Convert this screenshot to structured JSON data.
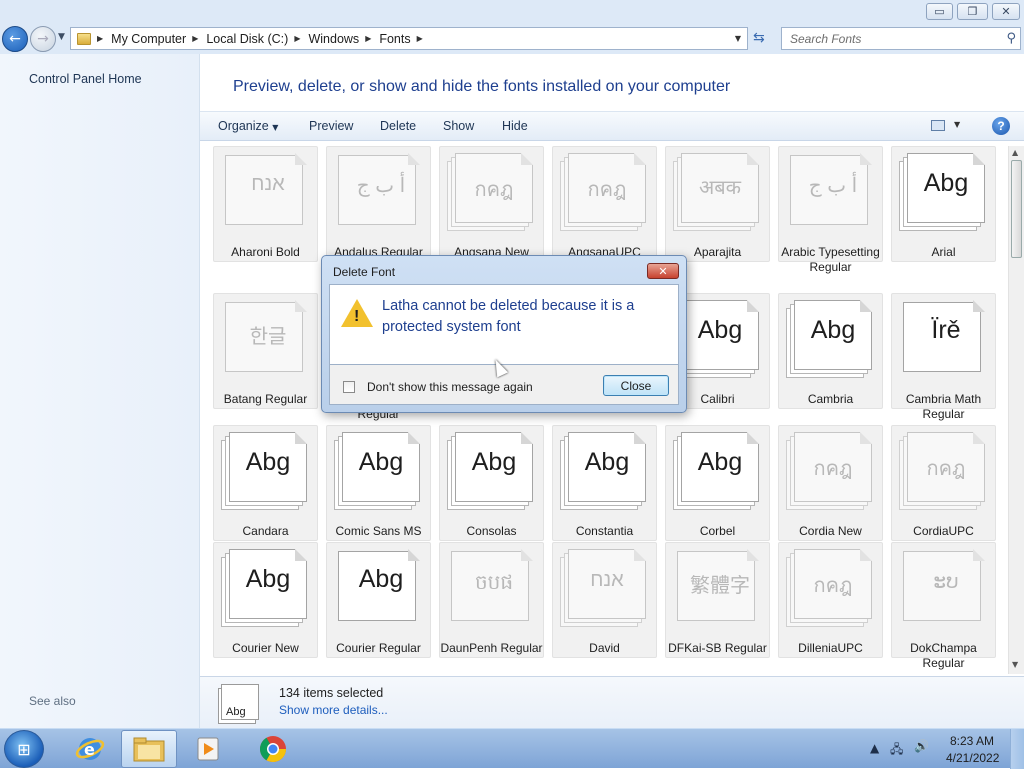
{
  "window": {
    "minimize_glyph": "▭",
    "restore_glyph": "❐",
    "close_glyph": "✕"
  },
  "nav": {
    "back_glyph": "←",
    "forward_glyph": "→"
  },
  "address": {
    "crumbs": [
      "My Computer",
      "Local Disk (C:)",
      "Windows",
      "Fonts"
    ]
  },
  "search": {
    "placeholder": "Search Fonts"
  },
  "sidebar": {
    "home_label": "Control Panel Home",
    "see_also_label": "See also"
  },
  "main": {
    "heading": "Preview, delete, or show and hide the fonts installed on your computer"
  },
  "toolbar": {
    "organize_label": "Organize",
    "preview_label": "Preview",
    "delete_label": "Delete",
    "show_label": "Show",
    "hide_label": "Hide",
    "help_label": "?"
  },
  "fonts": [
    {
      "name": "Aharoni Bold",
      "sample": "אנח",
      "disabled": true,
      "stack": false
    },
    {
      "name": "Andalus Regular",
      "sample": "أ ب ج",
      "disabled": true,
      "stack": false
    },
    {
      "name": "Angsana New",
      "sample": "กคฎ",
      "disabled": true,
      "stack": true
    },
    {
      "name": "AngsanaUPC",
      "sample": "กคฎ",
      "disabled": true,
      "stack": true
    },
    {
      "name": "Aparajita",
      "sample": "अबक",
      "disabled": true,
      "stack": true
    },
    {
      "name": "Arabic Typesetting Regular",
      "sample": "أ ب ج",
      "disabled": true,
      "stack": false
    },
    {
      "name": "Arial",
      "sample": "Abg",
      "disabled": false,
      "stack": true
    },
    {
      "name": "Batang Regular",
      "sample": "한글",
      "disabled": true,
      "stack": false
    },
    {
      "name": "Browallia New Regular",
      "sample": "",
      "disabled": true,
      "stack": true
    },
    {
      "name": "",
      "sample": "",
      "disabled": true,
      "stack": false
    },
    {
      "name": "",
      "sample": "",
      "disabled": true,
      "stack": false
    },
    {
      "name": "Calibri",
      "sample": "Abg",
      "disabled": false,
      "stack": true
    },
    {
      "name": "Cambria",
      "sample": "Abg",
      "disabled": false,
      "stack": true
    },
    {
      "name": "Cambria Math Regular",
      "sample": "Ïrě",
      "disabled": false,
      "stack": false
    },
    {
      "name": "Candara",
      "sample": "Abg",
      "disabled": false,
      "stack": true
    },
    {
      "name": "Comic Sans MS",
      "sample": "Abg",
      "disabled": false,
      "stack": true
    },
    {
      "name": "Consolas",
      "sample": "Abg",
      "disabled": false,
      "stack": true
    },
    {
      "name": "Constantia",
      "sample": "Abg",
      "disabled": false,
      "stack": true
    },
    {
      "name": "Corbel",
      "sample": "Abg",
      "disabled": false,
      "stack": true
    },
    {
      "name": "Cordia New",
      "sample": "กคฎ",
      "disabled": true,
      "stack": true
    },
    {
      "name": "CordiaUPC",
      "sample": "กคฎ",
      "disabled": true,
      "stack": true
    },
    {
      "name": "Courier New",
      "sample": "Abg",
      "disabled": false,
      "stack": true
    },
    {
      "name": "Courier Regular",
      "sample": "Abg",
      "disabled": false,
      "stack": false
    },
    {
      "name": "DaunPenh Regular",
      "sample": "ចបផ",
      "disabled": true,
      "stack": false
    },
    {
      "name": "David",
      "sample": "אנח",
      "disabled": true,
      "stack": true
    },
    {
      "name": "DFKai-SB Regular",
      "sample": "繁體字",
      "disabled": true,
      "stack": false
    },
    {
      "name": "DilleniaUPC",
      "sample": "กคฎ",
      "disabled": true,
      "stack": true
    },
    {
      "name": "DokChampa Regular",
      "sample": "ະບ",
      "disabled": true,
      "stack": false
    }
  ],
  "status": {
    "icon_text": "Abg",
    "count_text": "134 items selected",
    "more_link": "Show more details..."
  },
  "dialog": {
    "title": "Delete Font",
    "close_glyph": "✕",
    "message": "Latha cannot be deleted because it is a protected system font",
    "checkbox_label": "Don't show this message again",
    "close_button": "Close"
  },
  "taskbar": {
    "time": "8:23 AM",
    "date": "4/21/2022"
  }
}
